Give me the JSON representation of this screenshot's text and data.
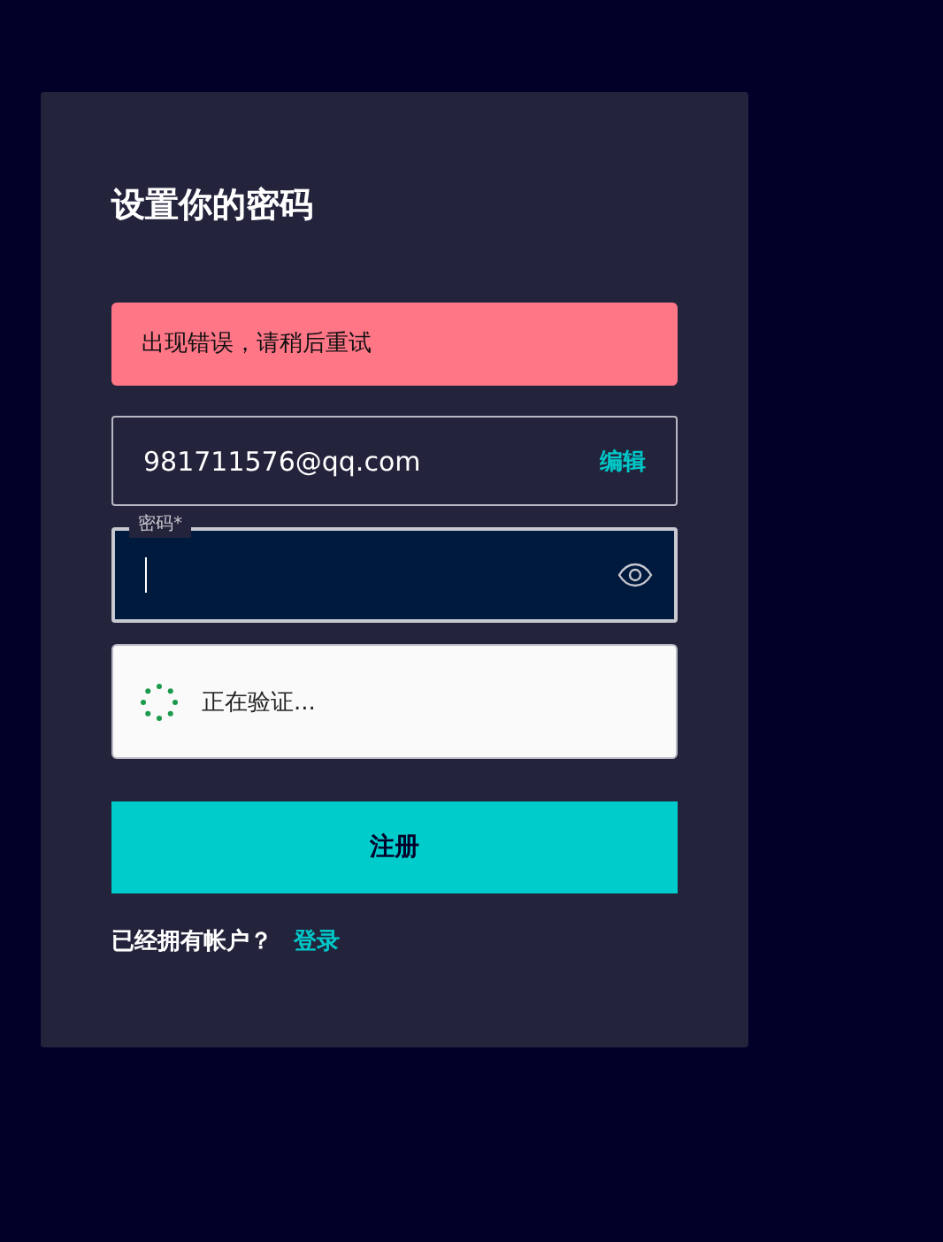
{
  "title": "设置你的密码",
  "error": "出现错误，请稍后重试",
  "email": {
    "value": "981711576@qq.com",
    "action": "编辑"
  },
  "password": {
    "label": "密码*",
    "focused": true
  },
  "captcha": {
    "status": "正在验证..."
  },
  "submit": "注册",
  "footer": {
    "text": "已经拥有帐户？",
    "link": "登录"
  }
}
